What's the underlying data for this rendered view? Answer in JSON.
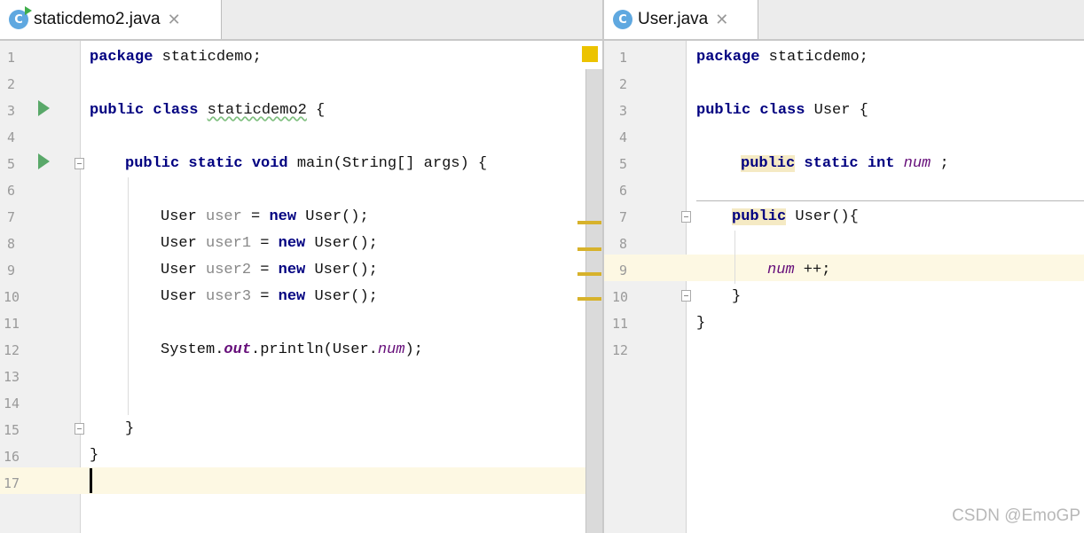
{
  "left_tab": {
    "icon_letter": "C",
    "name": "staticdemo2.java",
    "close": "✕"
  },
  "right_tab": {
    "icon_letter": "C",
    "name": "User.java",
    "close": "✕"
  },
  "left_lines": [
    "1",
    "2",
    "3",
    "4",
    "5",
    "6",
    "7",
    "8",
    "9",
    "10",
    "11",
    "12",
    "13",
    "14",
    "15",
    "16",
    "17"
  ],
  "right_lines": [
    "1",
    "2",
    "3",
    "4",
    "5",
    "6",
    "7",
    "8",
    "9",
    "10",
    "11",
    "12"
  ],
  "left_code": {
    "l1_kw": "package",
    "l1_rest": " staticdemo;",
    "l3_kw": "public class",
    "l3_name": "staticdemo2",
    "l3_rest": " {",
    "l5_kw": "public static void",
    "l5_rest": " main(String[] args) {",
    "l7_type": "User ",
    "l7_var": "user",
    "l7_eq": " = ",
    "l7_new": "new",
    "l7_rest": " User();",
    "l8_type": "User ",
    "l8_var": "user1",
    "l8_eq": " = ",
    "l8_new": "new",
    "l8_rest": " User();",
    "l9_type": "User ",
    "l9_var": "user2",
    "l9_eq": " = ",
    "l9_new": "new",
    "l9_rest": " User();",
    "l10_type": "User ",
    "l10_var": "user3",
    "l10_eq": " = ",
    "l10_new": "new",
    "l10_rest": " User();",
    "l12_a": "System.",
    "l12_out": "out",
    "l12_b": ".println(User.",
    "l12_num": "num",
    "l12_c": ");",
    "l15": "}",
    "l16": "}"
  },
  "right_code": {
    "l1_kw": "package",
    "l1_rest": " staticdemo;",
    "l3_kw": "public class",
    "l3_rest": " User {",
    "l5_pub": "public",
    "l5_kw": " static int ",
    "l5_num": "num",
    "l5_rest": " ;",
    "l7_pub": "public",
    "l7_rest": " User(){",
    "l9_num": "num",
    "l9_rest": " ++;",
    "l10": "}",
    "l11": "}"
  },
  "watermark": "CSDN @EmoGP",
  "colors": {
    "keyword": "#000080",
    "field": "#660e7a",
    "unused_var": "#888888",
    "current_line": "#fdf8e3",
    "tab_icon": "#5fa8e0"
  }
}
